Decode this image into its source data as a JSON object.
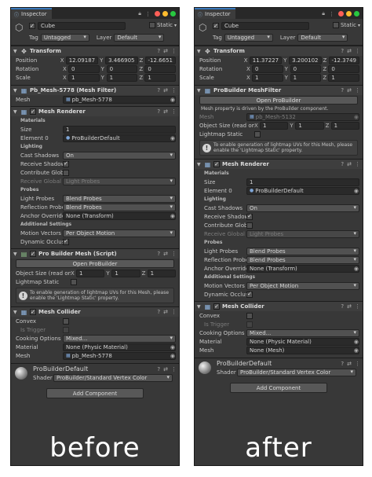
{
  "tab_label": "Inspector",
  "before": {
    "caption": "before",
    "object_name": "Cube",
    "static_label": "Static",
    "tag_label": "Tag",
    "tag_value": "Untagged",
    "layer_label": "Layer",
    "layer_value": "Default",
    "transform": {
      "title": "Transform",
      "position_label": "Position",
      "pos": [
        "12.09187",
        "3.466905",
        "-12.6651"
      ],
      "rotation_label": "Rotation",
      "rot": [
        "0",
        "0",
        "0"
      ],
      "scale_label": "Scale",
      "scl": [
        "1",
        "1",
        "1"
      ]
    },
    "mesh_filter": {
      "title": "Pb_Mesh-5778 (Mesh Filter)",
      "mesh_label": "Mesh",
      "mesh_value": "pb_Mesh-5778"
    },
    "mesh_renderer": {
      "title": "Mesh Renderer",
      "materials_label": "Materials",
      "size_label": "Size",
      "size_value": "1",
      "element0_label": "Element 0",
      "element0_value": "ProBuilderDefault",
      "lighting_label": "Lighting",
      "cast_shadows_label": "Cast Shadows",
      "cast_shadows_value": "On",
      "receive_shadows_label": "Receive Shadows",
      "contribute_gi_label": "Contribute Global Il",
      "receive_gi_label": "Receive Global Illur",
      "receive_gi_value": "Light Probes",
      "probes_label": "Probes",
      "light_probes_label": "Light Probes",
      "light_probes_value": "Blend Probes",
      "reflection_probes_label": "Reflection Probes",
      "reflection_probes_value": "Blend Probes",
      "anchor_label": "Anchor Override",
      "anchor_value": "None (Transform)",
      "additional_label": "Additional Settings",
      "motion_vectors_label": "Motion Vectors",
      "motion_vectors_value": "Per Object Motion",
      "dynamic_occlusion_label": "Dynamic Occlusion"
    },
    "pb_mesh": {
      "title": "Pro Builder Mesh (Script)",
      "open_button": "Open ProBuilder",
      "size_label": "Object Size (read only)",
      "size": [
        "1",
        "1",
        "1"
      ],
      "lightmap_static_label": "Lightmap Static",
      "help": "To enable generation of lightmap UVs for this Mesh, please enable the 'Lightmap Static' property."
    },
    "mesh_collider": {
      "title": "Mesh Collider",
      "convex_label": "Convex",
      "is_trigger_label": "Is Trigger",
      "cooking_label": "Cooking Options",
      "cooking_value": "Mixed...",
      "material_label": "Material",
      "material_value": "None (Physic Material)",
      "mesh_label": "Mesh",
      "mesh_value": "pb_Mesh-5778"
    },
    "material": {
      "title": "ProBuilderDefault",
      "shader_label": "Shader",
      "shader_value": "ProBuilder/Standard Vertex Color"
    },
    "add_component": "Add Component"
  },
  "after": {
    "caption": "after",
    "object_name": "Cube",
    "static_label": "Static",
    "tag_label": "Tag",
    "tag_value": "Untagged",
    "layer_label": "Layer",
    "layer_value": "Default",
    "transform": {
      "title": "Transform",
      "position_label": "Position",
      "pos": [
        "11.37227",
        "3.200102",
        "-12.3749"
      ],
      "rotation_label": "Rotation",
      "rot": [
        "0",
        "0",
        "0"
      ],
      "scale_label": "Scale",
      "scl": [
        "1",
        "1",
        "1"
      ]
    },
    "pb_meshfilter": {
      "title": "ProBuilder MeshFilter",
      "open_button": "Open ProBuilder",
      "info": "Mesh property is driven by the ProBuilder component.",
      "mesh_label": "Mesh",
      "mesh_value": "pb_Mesh-5132",
      "size_label": "Object Size (read only)",
      "size": [
        "1",
        "1",
        "1"
      ],
      "lightmap_static_label": "Lightmap Static",
      "help": "To enable generation of lightmap UVs for this Mesh, please enable the 'Lightmap Static' property."
    },
    "mesh_renderer": {
      "title": "Mesh Renderer",
      "materials_label": "Materials",
      "size_label": "Size",
      "size_value": "1",
      "element0_label": "Element 0",
      "element0_value": "ProBuilderDefault",
      "lighting_label": "Lighting",
      "cast_shadows_label": "Cast Shadows",
      "cast_shadows_value": "On",
      "receive_shadows_label": "Receive Shadows",
      "contribute_gi_label": "Contribute Global Il",
      "receive_gi_label": "Receive Global Illur",
      "receive_gi_value": "Light Probes",
      "probes_label": "Probes",
      "light_probes_label": "Light Probes",
      "light_probes_value": "Blend Probes",
      "reflection_probes_label": "Reflection Probes",
      "reflection_probes_value": "Blend Probes",
      "anchor_label": "Anchor Override",
      "anchor_value": "None (Transform)",
      "additional_label": "Additional Settings",
      "motion_vectors_label": "Motion Vectors",
      "motion_vectors_value": "Per Object Motion",
      "dynamic_occlusion_label": "Dynamic Occlusion"
    },
    "mesh_collider": {
      "title": "Mesh Collider",
      "convex_label": "Convex",
      "is_trigger_label": "Is Trigger",
      "cooking_label": "Cooking Options",
      "cooking_value": "Mixed...",
      "material_label": "Material",
      "material_value": "None (Physic Material)",
      "mesh_label": "Mesh",
      "mesh_value": "None (Mesh)"
    },
    "material": {
      "title": "ProBuilderDefault",
      "shader_label": "Shader",
      "shader_value": "ProBuilder/Standard Vertex Color"
    },
    "add_component": "Add Component"
  }
}
